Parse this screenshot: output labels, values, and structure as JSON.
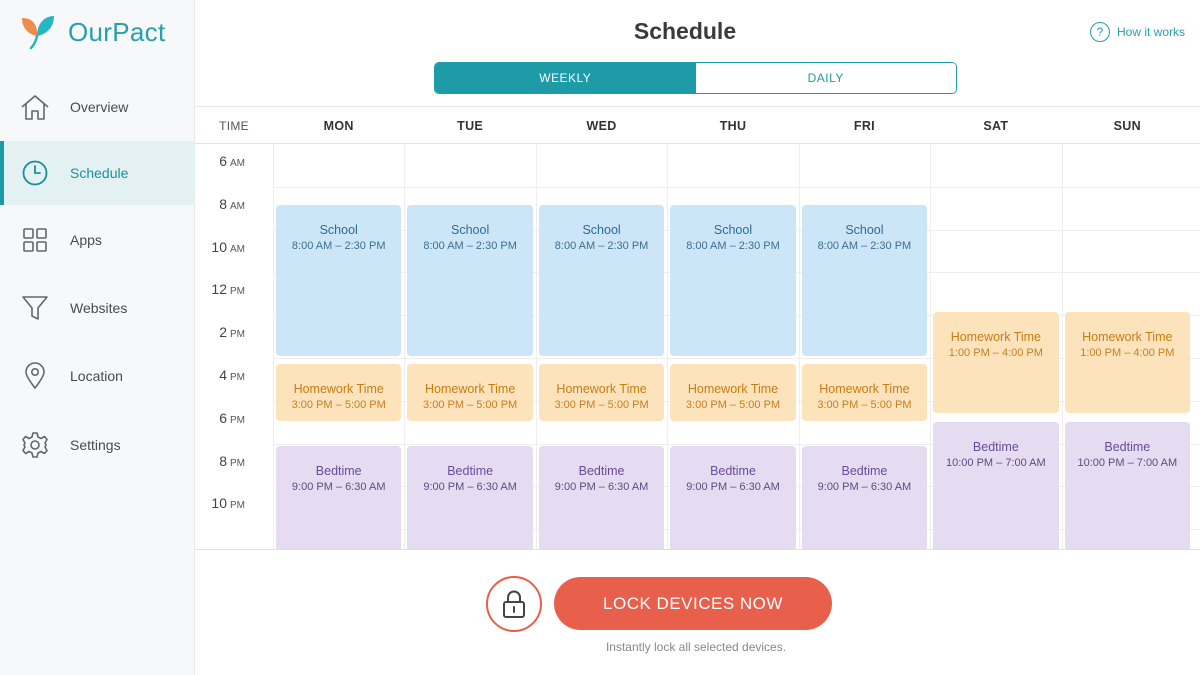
{
  "app": {
    "name": "OurPact"
  },
  "sidebar": {
    "items": [
      {
        "label": "Overview",
        "icon": "home-icon"
      },
      {
        "label": "Schedule",
        "icon": "clock-icon",
        "active": true
      },
      {
        "label": "Apps",
        "icon": "grid-icon"
      },
      {
        "label": "Websites",
        "icon": "filter-icon"
      },
      {
        "label": "Location",
        "icon": "location-pin-icon"
      },
      {
        "label": "Settings",
        "icon": "gear-icon"
      }
    ]
  },
  "header": {
    "title": "Schedule",
    "help_label": "How it works",
    "help_glyph": "?",
    "view_toggle": {
      "weekly": "WEEKLY",
      "daily": "DAILY",
      "selected": "WEEKLY"
    }
  },
  "schedule": {
    "time_header": "TIME",
    "days": [
      "MON",
      "TUE",
      "WED",
      "THU",
      "FRI",
      "SAT",
      "SUN"
    ],
    "time_labels": [
      {
        "h": "6",
        "p": "AM"
      },
      {
        "h": "8",
        "p": "AM"
      },
      {
        "h": "10",
        "p": "AM"
      },
      {
        "h": "12",
        "p": "PM"
      },
      {
        "h": "2",
        "p": "PM"
      },
      {
        "h": "4",
        "p": "PM"
      },
      {
        "h": "6",
        "p": "PM"
      },
      {
        "h": "8",
        "p": "PM"
      },
      {
        "h": "10",
        "p": "PM"
      }
    ],
    "weekday_events": [
      {
        "name": "School",
        "time": "8:00 AM – 2:30 PM",
        "kind": "school"
      },
      {
        "name": "Homework Time",
        "time": "3:00 PM – 5:00 PM",
        "kind": "hw"
      },
      {
        "name": "Bedtime",
        "time": "9:00 PM – 6:30 AM",
        "kind": "bed"
      }
    ],
    "weekend_events": [
      {
        "name": "Homework Time",
        "time": "1:00 PM – 4:00 PM",
        "kind": "hw"
      },
      {
        "name": "Bedtime",
        "time": "10:00 PM – 7:00 AM",
        "kind": "bed"
      }
    ]
  },
  "lock": {
    "button_label": "LOCK DEVICES NOW",
    "caption": "Instantly lock all selected devices."
  },
  "colors": {
    "accent": "#1f9aa7",
    "school": "#cce6f7",
    "homework": "#fde3bb",
    "bedtime": "#e6dcf2",
    "lock": "#e8604c"
  }
}
